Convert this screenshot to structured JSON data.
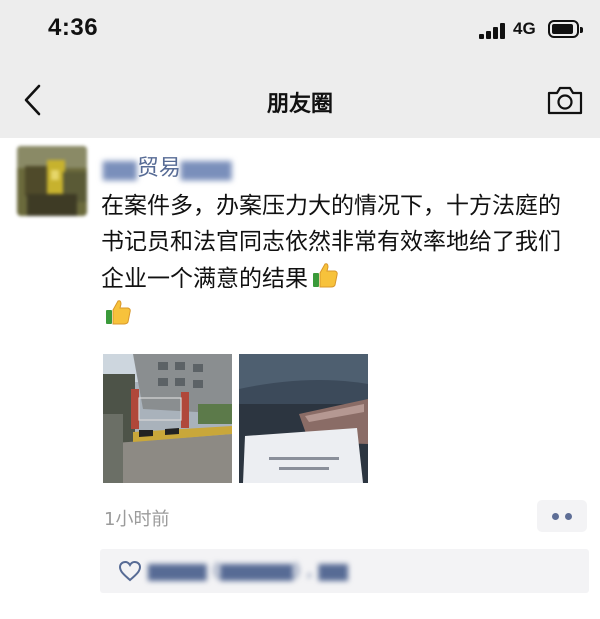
{
  "status_bar": {
    "time": "4:36",
    "network": "4G"
  },
  "nav": {
    "title": "朋友圈"
  },
  "post": {
    "author_clear": "贸易",
    "text": "在案件多，办案压力大的情况下，十方法庭的书记员和法官同志依然非常有效率地给了我们企业一个满意的结果",
    "time_ago": "1小时前"
  },
  "colors": {
    "link": "#576b95",
    "background": "#ededed",
    "card": "#ffffff",
    "muted": "#9b9b9b"
  },
  "icons": [
    "back-icon",
    "camera-icon",
    "thumbs-up-icon",
    "more-icon",
    "heart-icon",
    "signal-icon",
    "battery-icon"
  ]
}
